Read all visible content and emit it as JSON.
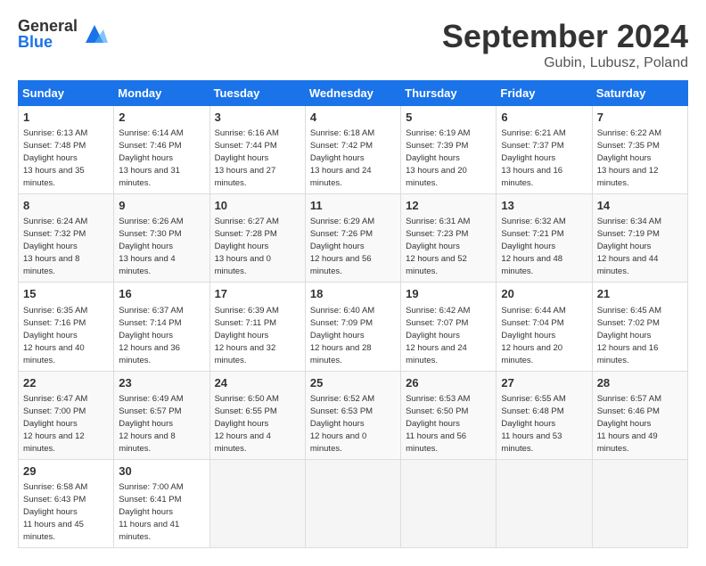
{
  "header": {
    "logo_general": "General",
    "logo_blue": "Blue",
    "month_title": "September 2024",
    "location": "Gubin, Lubusz, Poland"
  },
  "weekdays": [
    "Sunday",
    "Monday",
    "Tuesday",
    "Wednesday",
    "Thursday",
    "Friday",
    "Saturday"
  ],
  "weeks": [
    [
      {
        "day": "1",
        "sunrise": "6:13 AM",
        "sunset": "7:48 PM",
        "daylight": "13 hours and 35 minutes."
      },
      {
        "day": "2",
        "sunrise": "6:14 AM",
        "sunset": "7:46 PM",
        "daylight": "13 hours and 31 minutes."
      },
      {
        "day": "3",
        "sunrise": "6:16 AM",
        "sunset": "7:44 PM",
        "daylight": "13 hours and 27 minutes."
      },
      {
        "day": "4",
        "sunrise": "6:18 AM",
        "sunset": "7:42 PM",
        "daylight": "13 hours and 24 minutes."
      },
      {
        "day": "5",
        "sunrise": "6:19 AM",
        "sunset": "7:39 PM",
        "daylight": "13 hours and 20 minutes."
      },
      {
        "day": "6",
        "sunrise": "6:21 AM",
        "sunset": "7:37 PM",
        "daylight": "13 hours and 16 minutes."
      },
      {
        "day": "7",
        "sunrise": "6:22 AM",
        "sunset": "7:35 PM",
        "daylight": "13 hours and 12 minutes."
      }
    ],
    [
      {
        "day": "8",
        "sunrise": "6:24 AM",
        "sunset": "7:32 PM",
        "daylight": "13 hours and 8 minutes."
      },
      {
        "day": "9",
        "sunrise": "6:26 AM",
        "sunset": "7:30 PM",
        "daylight": "13 hours and 4 minutes."
      },
      {
        "day": "10",
        "sunrise": "6:27 AM",
        "sunset": "7:28 PM",
        "daylight": "13 hours and 0 minutes."
      },
      {
        "day": "11",
        "sunrise": "6:29 AM",
        "sunset": "7:26 PM",
        "daylight": "12 hours and 56 minutes."
      },
      {
        "day": "12",
        "sunrise": "6:31 AM",
        "sunset": "7:23 PM",
        "daylight": "12 hours and 52 minutes."
      },
      {
        "day": "13",
        "sunrise": "6:32 AM",
        "sunset": "7:21 PM",
        "daylight": "12 hours and 48 minutes."
      },
      {
        "day": "14",
        "sunrise": "6:34 AM",
        "sunset": "7:19 PM",
        "daylight": "12 hours and 44 minutes."
      }
    ],
    [
      {
        "day": "15",
        "sunrise": "6:35 AM",
        "sunset": "7:16 PM",
        "daylight": "12 hours and 40 minutes."
      },
      {
        "day": "16",
        "sunrise": "6:37 AM",
        "sunset": "7:14 PM",
        "daylight": "12 hours and 36 minutes."
      },
      {
        "day": "17",
        "sunrise": "6:39 AM",
        "sunset": "7:11 PM",
        "daylight": "12 hours and 32 minutes."
      },
      {
        "day": "18",
        "sunrise": "6:40 AM",
        "sunset": "7:09 PM",
        "daylight": "12 hours and 28 minutes."
      },
      {
        "day": "19",
        "sunrise": "6:42 AM",
        "sunset": "7:07 PM",
        "daylight": "12 hours and 24 minutes."
      },
      {
        "day": "20",
        "sunrise": "6:44 AM",
        "sunset": "7:04 PM",
        "daylight": "12 hours and 20 minutes."
      },
      {
        "day": "21",
        "sunrise": "6:45 AM",
        "sunset": "7:02 PM",
        "daylight": "12 hours and 16 minutes."
      }
    ],
    [
      {
        "day": "22",
        "sunrise": "6:47 AM",
        "sunset": "7:00 PM",
        "daylight": "12 hours and 12 minutes."
      },
      {
        "day": "23",
        "sunrise": "6:49 AM",
        "sunset": "6:57 PM",
        "daylight": "12 hours and 8 minutes."
      },
      {
        "day": "24",
        "sunrise": "6:50 AM",
        "sunset": "6:55 PM",
        "daylight": "12 hours and 4 minutes."
      },
      {
        "day": "25",
        "sunrise": "6:52 AM",
        "sunset": "6:53 PM",
        "daylight": "12 hours and 0 minutes."
      },
      {
        "day": "26",
        "sunrise": "6:53 AM",
        "sunset": "6:50 PM",
        "daylight": "11 hours and 56 minutes."
      },
      {
        "day": "27",
        "sunrise": "6:55 AM",
        "sunset": "6:48 PM",
        "daylight": "11 hours and 53 minutes."
      },
      {
        "day": "28",
        "sunrise": "6:57 AM",
        "sunset": "6:46 PM",
        "daylight": "11 hours and 49 minutes."
      }
    ],
    [
      {
        "day": "29",
        "sunrise": "6:58 AM",
        "sunset": "6:43 PM",
        "daylight": "11 hours and 45 minutes."
      },
      {
        "day": "30",
        "sunrise": "7:00 AM",
        "sunset": "6:41 PM",
        "daylight": "11 hours and 41 minutes."
      },
      null,
      null,
      null,
      null,
      null
    ]
  ]
}
